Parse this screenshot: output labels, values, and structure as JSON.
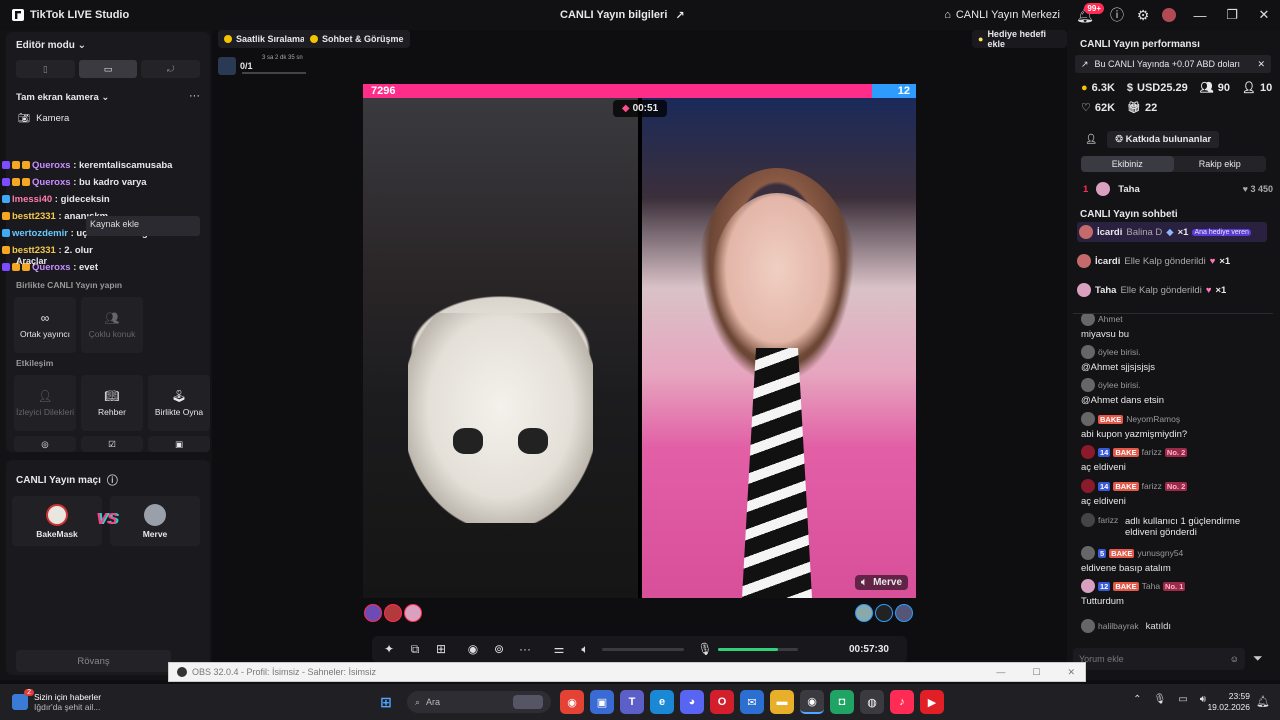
{
  "titlebar": {
    "app_name": "TikTok LIVE Studio",
    "center_title": "CANLI Yayın bilgileri",
    "live_center": "CANLI Yayın Merkezi",
    "notif_badge": "99+"
  },
  "left": {
    "editor_mode": "Editör modu",
    "fullscreen_camera": "Tam ekran kamera",
    "camera_label": "Kamera",
    "source_tooltip": "Kaynak ekle",
    "tools_label": "Araçlar",
    "chat": [
      {
        "name": "Queroxs",
        "text": ": keremtaliscamusaba"
      },
      {
        "name": "Queroxs",
        "text": ": bu kadro varya"
      },
      {
        "name": "lmessi40",
        "text": ": gideceksin"
      },
      {
        "name": "bestt2331",
        "text": ": ananıskm"
      },
      {
        "name": "wertozdemir",
        "text": ": uçak sıkıntı değil"
      },
      {
        "name": "bestt2331",
        "text": ": 2. olur"
      },
      {
        "name": "Queroxs",
        "text": ": evet"
      }
    ],
    "together_title": "Birlikte CANLI Yayın yapın",
    "cohost": "Ortak yayıncı",
    "multi_guest": "Çoklu konuk",
    "interaction_title": "Etkileşim",
    "viewer_requests": "İzleyici Dilekleri",
    "guide": "Rehber",
    "play_together": "Birlikte Oyna",
    "match_title": "CANLI Yayın maçı",
    "player1": "BakeMask",
    "player2": "Merve",
    "vs": "VS",
    "rematch": "Rövanş"
  },
  "center": {
    "hourly_ranking": "Saatlik Sıralama",
    "chat_meet": "Sohbet & Görüşme",
    "gift_goal": "Hediye hedefi ekle",
    "goal_progress": "0/1",
    "goal_time": "3 sa 2 dk 35 sn",
    "score_left": "7296",
    "score_right": "12",
    "battle_timer": "00:51",
    "right_streamer": "Merve",
    "stream_time": "00:57:30",
    "volume_level": 0.75
  },
  "right": {
    "perf_title": "CANLI Yayın performansı",
    "banner": "Bu CANLI Yayında +0.07 ABD doları",
    "stats": {
      "coins": "6.3K",
      "usd": "USD25.29",
      "viewers": "90",
      "follows": "10",
      "likes": "62K",
      "gifts": "22"
    },
    "contributors": "Katkıda bulunanlar",
    "tab_team": "Ekibiniz",
    "tab_rival": "Rakip ekip",
    "top_rank": "1",
    "top_name": "Taha",
    "top_score": "450",
    "chat_title": "CANLI Yayın sohbeti",
    "gifts": [
      {
        "user": "İcardi",
        "action": "Balina D",
        "count": "×1",
        "tag": "Ana hediye veren"
      },
      {
        "user": "İcardi",
        "action": "Elle Kalp gönderildi",
        "count": "×1"
      },
      {
        "user": "Taha",
        "action": "Elle Kalp gönderildi",
        "count": "×1"
      }
    ],
    "comments": [
      {
        "user": "Ahmet",
        "text": "miyavsu bu"
      },
      {
        "user": "öylee birisi.",
        "text": "@Ahmet sjjsjsjsjs"
      },
      {
        "user": "öylee birisi.",
        "text": "@Ahmet dans etsin"
      },
      {
        "user": "NeyomRamoş",
        "fan": "BAKE",
        "text": "abi kupon yazmişmiydin?"
      },
      {
        "user": "farizz",
        "lvl": "14",
        "fan": "BAKE",
        "rank": "No. 2",
        "text": "aç eldiveni"
      },
      {
        "user": "farizz",
        "lvl": "14",
        "fan": "BAKE",
        "rank": "No. 2",
        "text": "aç eldiveni"
      },
      {
        "user": "farizz",
        "text": "adlı kullanıcı 1 güçlendirme eldiveni gönderdi"
      },
      {
        "user": "yunusgny54",
        "lvl": "5",
        "fan": "BAKE",
        "text": "eldivene basıp atalım"
      },
      {
        "user": "Taha",
        "lvl": "12",
        "fan": "BAKE",
        "rank": "No. 1",
        "text": "Tutturdum"
      },
      {
        "user": "halilbayrak",
        "text": "katıldı"
      }
    ],
    "comment_placeholder": "Yorum ekle"
  },
  "obs": {
    "title": "OBS 32.0.4 - Profil: İsimsiz - Sahneler: İsimsiz"
  },
  "taskbar": {
    "news_title": "Sizin için haberler",
    "news_sub": "Iğdır'da şehit ail...",
    "news_badge": "2",
    "search_placeholder": "Ara",
    "time": "23:59",
    "date": "19.02.2026"
  }
}
